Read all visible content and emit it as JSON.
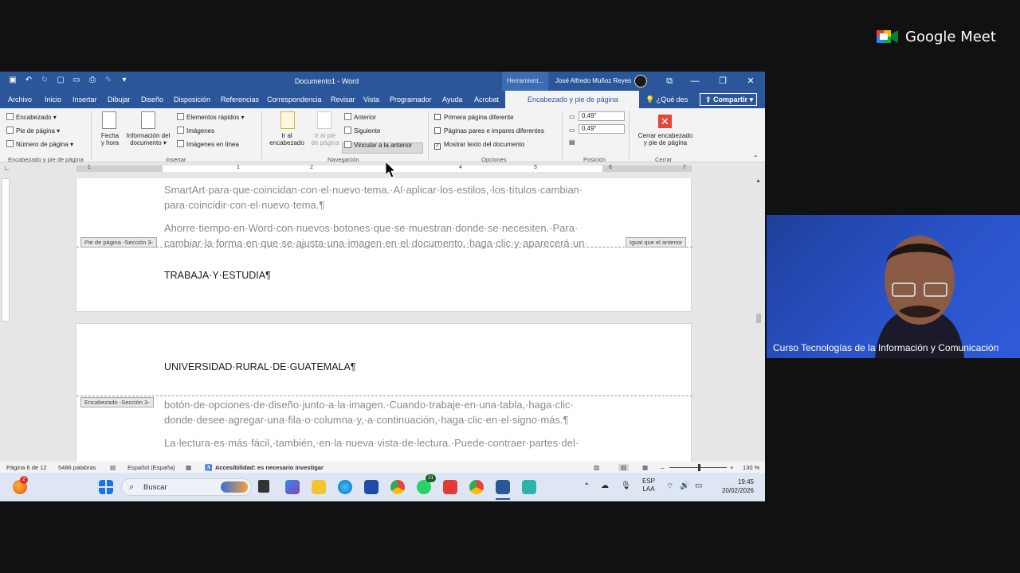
{
  "meet": {
    "brand": "Google Meet"
  },
  "word": {
    "title": "Documento1  -  Word",
    "tools_label": "Herramient...",
    "user": "José Alfredo Muñoz Reyes",
    "tabs": [
      "Archivo",
      "Inicio",
      "Insertar",
      "Dibujar",
      "Diseño",
      "Disposición",
      "Referencias",
      "Correspondencia",
      "Revisar",
      "Vista",
      "Programador",
      "Ayuda",
      "Acrobat"
    ],
    "active_tab": "Encabezado y pie de página",
    "tell_me": "¿Qué des",
    "share": "Compartir",
    "ribbon": {
      "hf_group": {
        "items": [
          "Encabezado",
          "Pie de página",
          "Número de página"
        ],
        "label": "Encabezado y pie de página"
      },
      "insert_group": {
        "fecha": "Fecha y hora",
        "fecha_l1": "Fecha",
        "fecha_l2": "y hora",
        "info_l1": "Información del",
        "info_l2": "documento",
        "items": [
          "Elementos rápidos",
          "Imágenes",
          "Imágenes en línea"
        ],
        "label": "Insertar"
      },
      "nav_group": {
        "ir_enc_l1": "Ir al",
        "ir_enc_l2": "encabezado",
        "ir_pie_l1": "Ir al pie",
        "ir_pie_l2": "de página",
        "items": [
          "Anterior",
          "Siguiente",
          "Vincular a la anterior"
        ],
        "label": "Navegación"
      },
      "options_group": {
        "items": [
          "Primera página diferente",
          "Páginas pares e impares diferentes",
          "Mostrar texto del documento"
        ],
        "label": "Opciones"
      },
      "position_group": {
        "top": "0,49\"",
        "bottom": "0,49\"",
        "label": "Posición"
      },
      "close_group": {
        "l1": "Cerrar encabezado",
        "l2": "y pie de página",
        "label": "Cerrar"
      }
    },
    "ruler_nums": [
      "1",
      "1",
      "2",
      "3",
      "4",
      "5",
      "6",
      "7"
    ],
    "document": {
      "p1_l1": "SmartArt·para·que·coincidan·con·el·nuevo·tema.·Al·aplicar·los·estilos,·los·títulos·cambian·",
      "p1_l2": "para·coincidir·con·el·nuevo·tema.¶",
      "p2_l1": "Ahorre·tiempo·en·Word·con·nuevos·botones·que·se·muestran·donde·se·necesiten.·Para·",
      "p2_l2": "cambiar·la·forma·en·que·se·ajusta·una·imagen·en·el·documento,·haga·clic·y·aparecerá·un·",
      "footer_tag": "Pie de página -Sección 3-",
      "same_prev": "Igual que el anterior",
      "footer_text": "TRABAJA·Y·ESTUDIA¶",
      "header_text": "UNIVERSIDAD·RURAL·DE·GUATEMALA¶",
      "header_tag": "Encabezado -Sección 3-",
      "p3_l1": "botón·de·opciones·de·diseño·junto·a·la·imagen.·Cuando·trabaje·en·una·tabla,·haga·clic·",
      "p3_l2": "donde·desee·agregar·una·fila·o·columna·y,·a·continuación,·haga·clic·en·el·signo·más.¶",
      "p4_l1": "La·lectura·es·más·fácil,·también,·en·la·nueva·vista·de·lectura.·Puede·contraer·partes·del·"
    },
    "status": {
      "page": "Página 6 de 12",
      "words": "5486 palabras",
      "lang": "Español (España)",
      "access": "Accesibilidad: es necesario investigar",
      "zoom": "130 %"
    }
  },
  "taskbar": {
    "search": "Buscar",
    "lang1": "ESP",
    "lang2": "LAA",
    "time": "19:45",
    "date": "20/02/2026",
    "badge_firefox": "2",
    "badge_whatsapp": "21"
  },
  "video": {
    "caption": "Curso Tecnologías de la Información y Comunicación"
  }
}
